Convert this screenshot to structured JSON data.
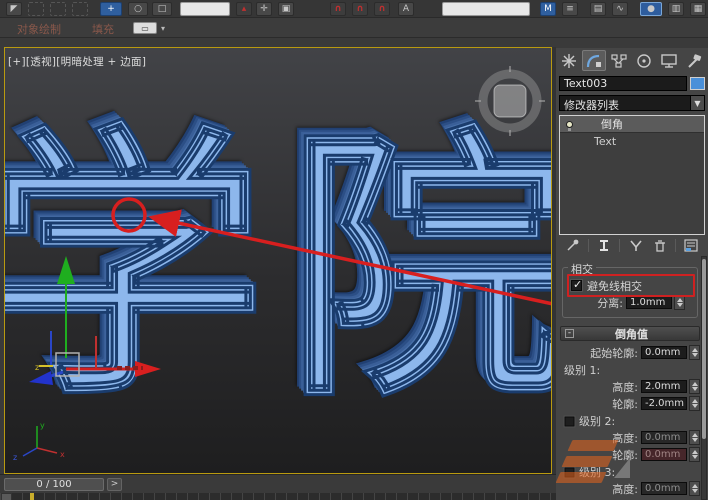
{
  "colors": {
    "annotation_red": "#cf2121",
    "text_face_blue": "#8db7ec",
    "text_edge_navy": "#1a3c6d",
    "object_swatch_blue": "#4a90d9",
    "viewport_border_yellow": "#b99a10"
  },
  "toolbar": {
    "icon_names": [
      "select-object",
      "rectangular-selection-region",
      "selection-filter",
      "select-and-move",
      "select-and-rotate",
      "select-and-scale",
      "reference-coordinate-dropdown",
      "use-pivot-point-center",
      "select-and-manipulate",
      "snap-toggle-3d",
      "angle-snap-toggle",
      "percent-snap-toggle",
      "named-selection-set-dropdown",
      "mirror",
      "align",
      "layer-manager",
      "curve-editor",
      "material-editor",
      "render-setup"
    ],
    "caret": "▾",
    "magnet_glyph": "∩",
    "mirror_glyph": "M"
  },
  "ribbon": {
    "tabs": [
      {
        "label": "对象绘制"
      },
      {
        "label": "填充"
      }
    ],
    "dropdown_glyph": "▭",
    "caret": "▾"
  },
  "viewport": {
    "label": "[+][透视][明暗处理 + 边面]",
    "text_left": "学",
    "text_right": "院",
    "axis_labels": {
      "x": "x",
      "y": "y",
      "z": "z"
    }
  },
  "command_panel": {
    "tab_names": [
      "create",
      "modify",
      "hierarchy",
      "motion",
      "display",
      "utilities"
    ],
    "object_name": "Text003",
    "modifier_list_label": "修改器列表",
    "modifier_stack": {
      "items": [
        {
          "label": "倒角"
        },
        {
          "label": "Text"
        }
      ]
    },
    "stack_tool_names": [
      "pin-stack",
      "show-end-result",
      "make-unique",
      "remove-modifier",
      "configure-modifier-sets"
    ],
    "intersection": {
      "title": "相交",
      "avoid_label": "避免线相交",
      "avoid_checked": "✓",
      "separation_label": "分离:",
      "separation_value": "1.0mm"
    },
    "bevel": {
      "title": "倒角值",
      "collapse_glyph": "-",
      "start_outline_label": "起始轮廓:",
      "start_outline_value": "0.0mm",
      "level1": {
        "label": "级别 1:",
        "height_label": "高度:",
        "height_value": "2.0mm",
        "outline_label": "轮廓:",
        "outline_value": "-2.0mm"
      },
      "level2": {
        "label": "级别 2:",
        "height_label": "高度:",
        "height_value": "0.0mm",
        "outline_label": "轮廓:",
        "outline_value": "0.0mm"
      },
      "level3": {
        "label": "级别 3:",
        "height_label": "高度:",
        "height_value": "0.0mm"
      }
    }
  },
  "timeline": {
    "frame_indicator": "0 / 100",
    "next_frame_button": ">"
  }
}
